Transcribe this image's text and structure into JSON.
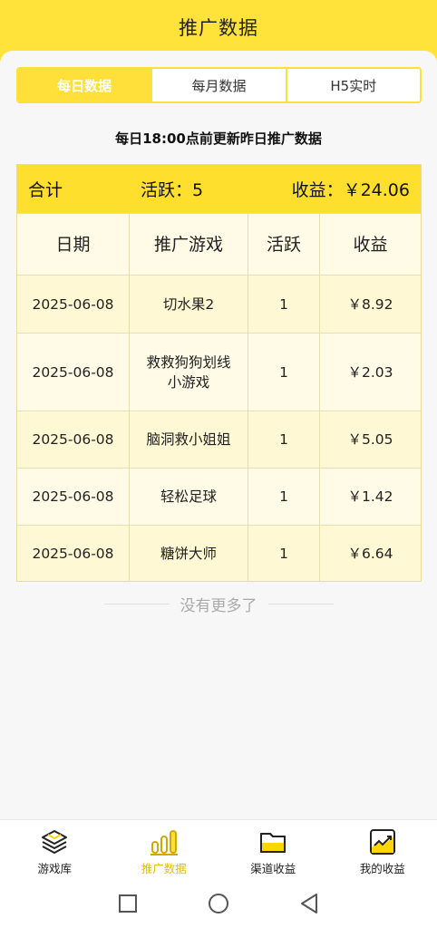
{
  "header": {
    "title": "推广数据"
  },
  "tabs": [
    {
      "label": "每日数据",
      "active": true
    },
    {
      "label": "每月数据",
      "active": false
    },
    {
      "label": "H5实时",
      "active": false
    }
  ],
  "notice": "每日18:00点前更新昨日推广数据",
  "summary": {
    "total_label": "合计",
    "active_text": "活跃：5",
    "income_text": "收益：￥24.06"
  },
  "table": {
    "headers": [
      "日期",
      "推广游戏",
      "活跃",
      "收益"
    ],
    "rows": [
      {
        "date": "2025-06-08",
        "game": "切水果2",
        "active": "1",
        "income": "￥8.92"
      },
      {
        "date": "2025-06-08",
        "game": "救救狗狗划线小游戏",
        "active": "1",
        "income": "￥2.03"
      },
      {
        "date": "2025-06-08",
        "game": "脑洞救小姐姐",
        "active": "1",
        "income": "￥5.05"
      },
      {
        "date": "2025-06-08",
        "game": "轻松足球",
        "active": "1",
        "income": "￥1.42"
      },
      {
        "date": "2025-06-08",
        "game": "糖饼大师",
        "active": "1",
        "income": "￥6.64"
      }
    ]
  },
  "no_more": "没有更多了",
  "bottom_nav": [
    {
      "label": "游戏库",
      "icon": "layers-icon",
      "active": false
    },
    {
      "label": "推广数据",
      "icon": "bar-chart-icon",
      "active": true
    },
    {
      "label": "渠道收益",
      "icon": "folder-icon",
      "active": false
    },
    {
      "label": "我的收益",
      "icon": "trend-chart-icon",
      "active": false
    }
  ],
  "colors": {
    "accent": "#ffe23a",
    "active_nav": "#e8bc00"
  }
}
